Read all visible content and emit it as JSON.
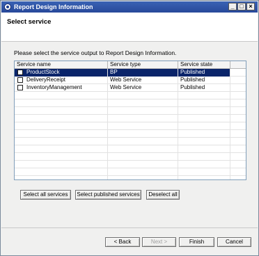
{
  "window": {
    "title": "Report Design Information",
    "minimize_glyph": "_",
    "maximize_glyph": "□",
    "close_glyph": "×"
  },
  "header": {
    "title": "Select service"
  },
  "instruction": "Please select the service output to Report Design Information.",
  "table": {
    "columns": [
      "Service name",
      "Service type",
      "Service state"
    ],
    "rows": [
      {
        "name": "ProductStock",
        "type": "BP",
        "state": "Published",
        "selected": true,
        "checked": false
      },
      {
        "name": "DeliveryReceipt",
        "type": "Web Service",
        "state": "Published",
        "selected": false,
        "checked": false
      },
      {
        "name": "InventoryManagement",
        "type": "Web Service",
        "state": "Published",
        "selected": false,
        "checked": false
      }
    ]
  },
  "selection_buttons": {
    "select_all": "Select all services",
    "select_published": "Select published services",
    "deselect_all": "Deselect all"
  },
  "wizard_buttons": {
    "back": "< Back",
    "next": "Next >",
    "finish": "Finish",
    "cancel": "Cancel"
  },
  "colors": {
    "titlebar": "#27489a",
    "selection": "#0a246a"
  }
}
